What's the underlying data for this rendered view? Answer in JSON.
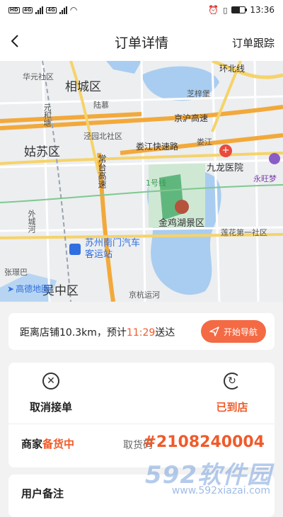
{
  "status_bar": {
    "network_badges": [
      "HD",
      "4G",
      "4G"
    ],
    "time": "13:36",
    "battery_level": 0.6
  },
  "header": {
    "back_icon": "chevron-left-icon",
    "title": "订单详情",
    "track_link": "订单跟踪"
  },
  "map": {
    "labels": {
      "huayuan": "华元社区",
      "xiangcheng": "相城区",
      "luxu": "陆慕",
      "zhizhu": "芝梓堡",
      "huanbei": "环北线",
      "yuanhe": "元和塘",
      "jinghu": "京沪高速",
      "jingquan": "泾园北社区",
      "gusu": "姑苏区",
      "changtai": "常台高速",
      "loujiang": "娄江快速路",
      "loujiang2": "娄江",
      "jiulong": "九龙医院",
      "yongwang": "永旺梦",
      "metro1": "1号线",
      "jinjihu": "金鸡湖景区",
      "lianhua": "莲花第一社区",
      "waicheng": "外城河",
      "busstation": "苏州南门汽车客运站",
      "zhangjing": "张璟巴",
      "wuzhong": "吴中区",
      "jinghang": "京杭运河",
      "amap": "高德地图"
    }
  },
  "distance_card": {
    "prefix": "距离店铺10.3km，预计",
    "eta": "11:29",
    "suffix": "送达",
    "nav_button": "开始导航"
  },
  "actions": {
    "cancel_label": "取消接单",
    "arrived_label": "已到店"
  },
  "merchant": {
    "prefix": "商家",
    "status": "备货中",
    "pickup_label": "取货码",
    "pickup_code": "#2108240004"
  },
  "remark": {
    "label": "用户备注"
  },
  "watermark": {
    "main": "592软件园",
    "url": "www.592xiazai.com"
  },
  "colors": {
    "accent": "#f05a2a",
    "nav_button": "#f46a44",
    "water": "#a9cdf0",
    "park": "#4cae6e",
    "highway": "#f2a93b"
  }
}
